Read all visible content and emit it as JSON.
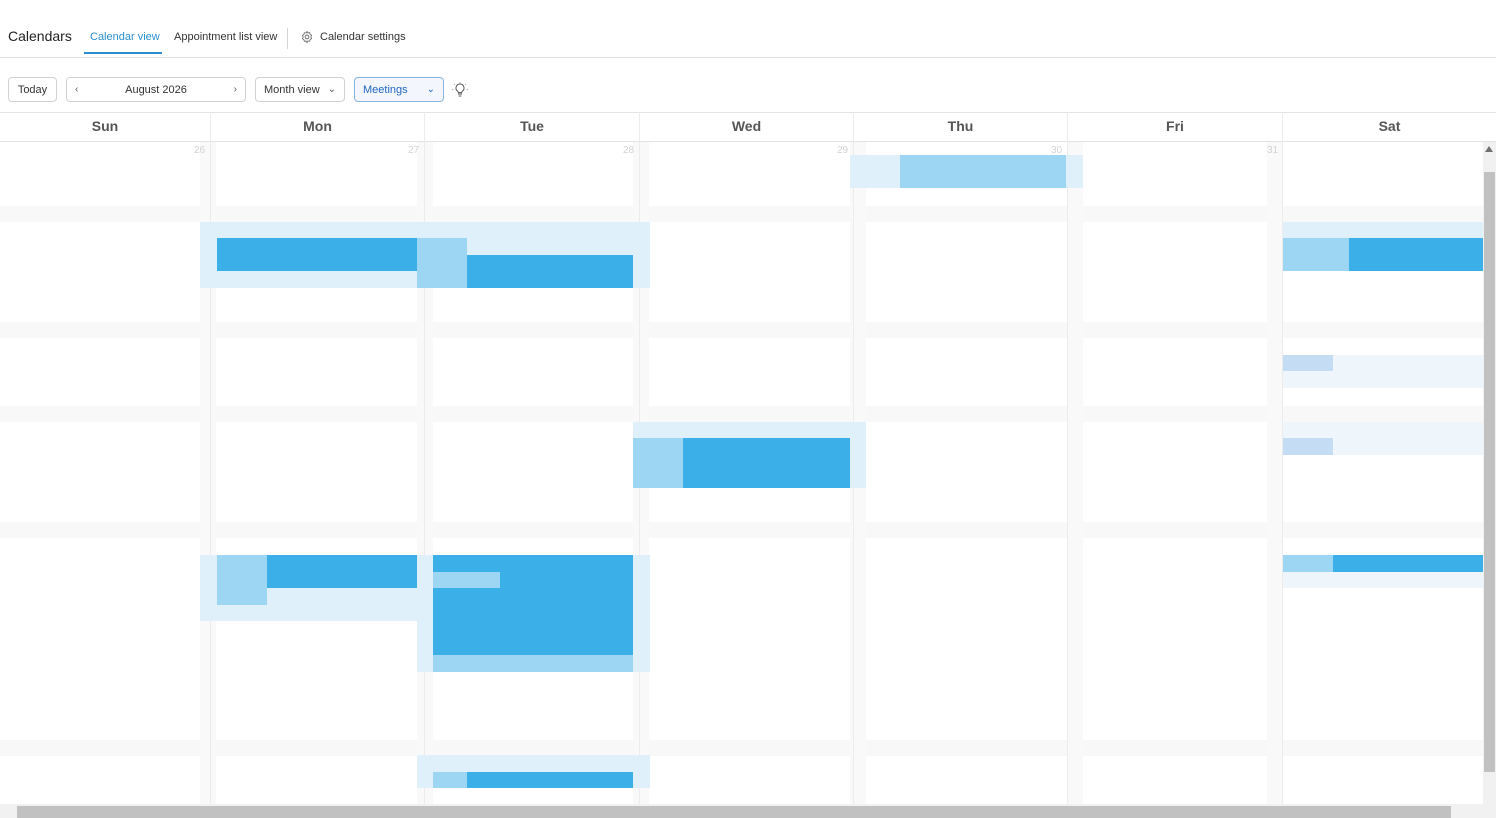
{
  "header": {
    "title": "Calendars",
    "tabs": [
      {
        "label": "Calendar view"
      },
      {
        "label": "Appointment list view"
      },
      {
        "label": "Calendar settings"
      }
    ]
  },
  "toolbar": {
    "today_label": "Today",
    "month_label": "August 2026",
    "view_label": "Month view",
    "filter_label": "Meetings"
  },
  "week": {
    "days": [
      "Sun",
      "Mon",
      "Tue",
      "Wed",
      "Thu",
      "Fri",
      "Sat"
    ],
    "first_row_numbers": [
      "26",
      "27",
      "28",
      "29",
      "30",
      "31"
    ]
  },
  "colors": {
    "accent": "#2a8fcf",
    "event_strong": "#3bb0e8",
    "event_mid": "#9cd6f3",
    "event_light": "#dff0fb"
  },
  "icons": {
    "settings": "gear-icon",
    "prev": "chevron-left-icon",
    "next": "chevron-right-icon",
    "dropdown": "chevron-down-icon",
    "theme": "lightbulb-icon"
  }
}
